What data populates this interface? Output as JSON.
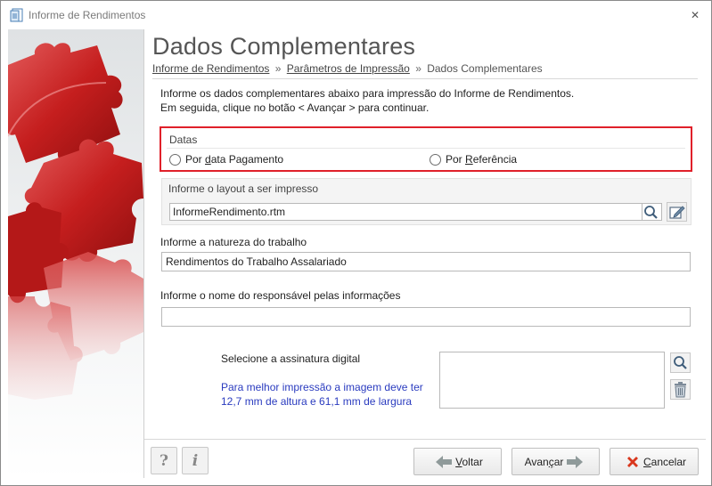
{
  "window": {
    "title": "Informe de Rendimentos",
    "close_glyph": "✕"
  },
  "header": {
    "title": "Dados Complementares",
    "breadcrumb": [
      {
        "label": "Informe de Rendimentos",
        "link": true
      },
      {
        "label": "Parâmetros de Impressão",
        "link": true
      },
      {
        "label": "Dados Complementares",
        "link": false
      }
    ],
    "separator": "»"
  },
  "intro": {
    "line1": "Informe os dados complementares abaixo para impressão do Informe de Rendimentos.",
    "line2": "Em seguida, clique no botão < Avançar > para continuar."
  },
  "datas": {
    "label": "Datas",
    "options": [
      {
        "label_pre": "Por ",
        "label_mnemonic": "d",
        "label_post": "ata Pagamento",
        "selected": false
      },
      {
        "label_pre": "Por ",
        "label_mnemonic": "R",
        "label_post": "eferência",
        "selected": false
      }
    ]
  },
  "layout": {
    "label": "Informe o layout a ser impresso",
    "value": "InformeRendimento.rtm"
  },
  "natureza": {
    "label": "Informe a natureza do trabalho",
    "value": "Rendimentos do Trabalho Assalariado"
  },
  "responsavel": {
    "label": "Informe o nome do responsável pelas informações",
    "value": ""
  },
  "assinatura": {
    "label": "Selecione a assinatura digital",
    "hint_line1": "Para melhor impressão a imagem deve ter",
    "hint_line2": "12,7 mm de altura e 61,1 mm de largura"
  },
  "footer": {
    "help_glyph": "?",
    "info_glyph": "i",
    "voltar": {
      "mnemonic": "V",
      "rest": "oltar"
    },
    "avancar": {
      "pre": "Avan",
      "mnemonic": "ç",
      "post": "ar"
    },
    "cancelar": {
      "mnemonic": "C",
      "rest": "ancelar"
    }
  },
  "colors": {
    "highlight_border": "#e0202a",
    "hint_text": "#2a3bbf",
    "arrow_green": "#7f8f8f",
    "cancel_red": "#d9371d"
  },
  "icons": [
    "app-icon",
    "close-icon",
    "search-icon",
    "edit-icon",
    "trash-icon",
    "help-icon",
    "info-icon",
    "arrow-left-icon",
    "arrow-right-icon",
    "cancel-x-icon"
  ]
}
